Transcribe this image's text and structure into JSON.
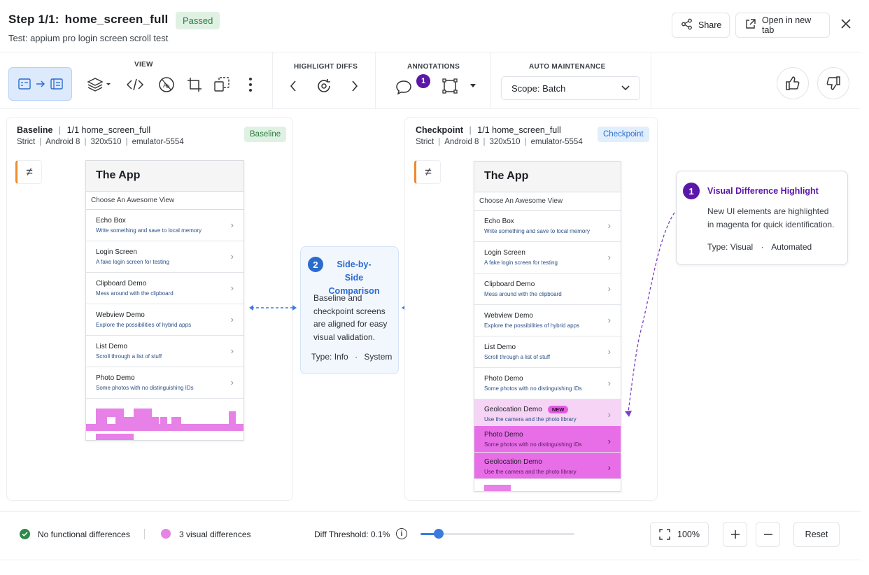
{
  "header": {
    "step_label": "Step 1/1:",
    "step_name": "home_screen_full",
    "status": "Passed",
    "test_name": "Test: appium pro login screen scroll test",
    "share_label": "Share",
    "open_new_tab_label": "Open in new tab"
  },
  "toolbar": {
    "view_label": "VIEW",
    "highlight_diffs_label": "HIGHLIGHT DIFFS",
    "annotations_label": "ANNOTATIONS",
    "annotations_count": "1",
    "auto_maintenance_label": "AUTO MAINTENANCE",
    "scope_value": "Scope: Batch"
  },
  "baseline": {
    "title": "Baseline",
    "path": "1/1 home_screen_full",
    "meta": [
      "Strict",
      "Android 8",
      "320x510",
      "emulator-5554"
    ],
    "tag": "Baseline"
  },
  "checkpoint": {
    "title": "Checkpoint",
    "path": "1/1 home_screen_full",
    "meta": [
      "Strict",
      "Android 8",
      "320x510",
      "emulator-5554"
    ],
    "tag": "Checkpoint"
  },
  "neq_symbol": "≠",
  "app": {
    "title": "The App",
    "subtitle": "Choose An Awesome View",
    "rows": [
      {
        "title": "Echo Box",
        "sub": "Write something and save to local memory"
      },
      {
        "title": "Login Screen",
        "sub": "A fake login screen for testing"
      },
      {
        "title": "Clipboard Demo",
        "sub": "Mess around with the clipboard"
      },
      {
        "title": "Webview Demo",
        "sub": "Explore the possibilities of hybrid apps"
      },
      {
        "title": "List Demo",
        "sub": "Scroll through a list of stuff"
      },
      {
        "title": "Photo Demo",
        "sub": "Some photos with no distinguishing IDs"
      }
    ],
    "new_rows": [
      {
        "title": "Geolocation Demo",
        "sub": "Use the camera and the photo library",
        "badge": "NEW"
      },
      {
        "title": "Photo Demo",
        "sub": "Some photos with no distinguishing IDs"
      },
      {
        "title": "Geolocation Demo",
        "sub": "Use the camera and the photo library"
      }
    ],
    "chevron": "›"
  },
  "callout_side": {
    "num": "2",
    "title_line1": "Side-by-Side",
    "title_line2": "Comparison",
    "body": [
      "Baseline and",
      "checkpoint screens",
      "are aligned for easy",
      "visual validation."
    ],
    "type_label": "Type:",
    "type_value": "Info",
    "type_source": "System"
  },
  "callout_visual": {
    "num": "1",
    "title": "Visual Difference Highlight",
    "body": [
      "New UI elements are highlighted",
      "in magenta for quick identification."
    ],
    "type_label": "Type:",
    "type_value": "Visual",
    "type_source": "Automated"
  },
  "footer": {
    "functional": "No functional differences",
    "visual": "3 visual differences",
    "threshold_label": "Diff Threshold: 0.1%",
    "slider_fraction": 0.12,
    "zoom": "100%",
    "reset_label": "Reset"
  },
  "colors": {
    "accent_blue": "#2a6bd0",
    "magenta": "#e86ee8",
    "purple": "#5b17a8",
    "green": "#2c8a4a"
  }
}
